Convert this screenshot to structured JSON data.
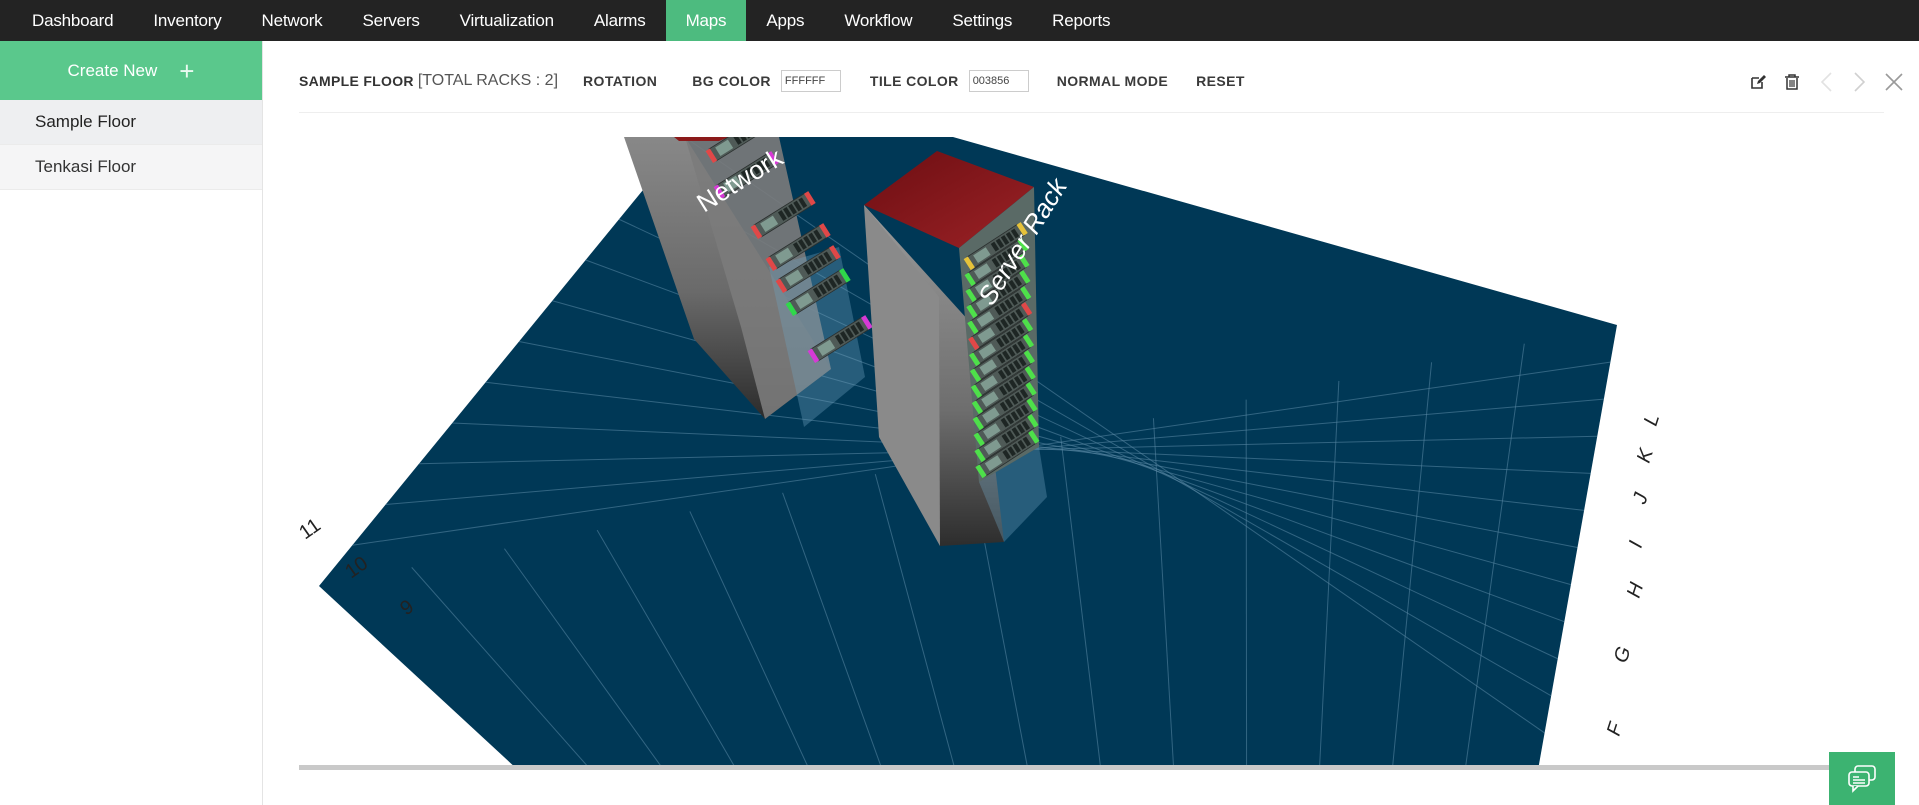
{
  "nav": {
    "items": [
      {
        "label": "Dashboard",
        "active": false
      },
      {
        "label": "Inventory",
        "active": false
      },
      {
        "label": "Network",
        "active": false
      },
      {
        "label": "Servers",
        "active": false
      },
      {
        "label": "Virtualization",
        "active": false
      },
      {
        "label": "Alarms",
        "active": false
      },
      {
        "label": "Maps",
        "active": true
      },
      {
        "label": "Apps",
        "active": false
      },
      {
        "label": "Workflow",
        "active": false
      },
      {
        "label": "Settings",
        "active": false
      },
      {
        "label": "Reports",
        "active": false
      }
    ],
    "active_color": "#4dbb7f"
  },
  "sidebar": {
    "create_new_label": "Create New",
    "create_new_icon": "plus-icon",
    "floors": [
      {
        "label": "Sample Floor",
        "active": true
      },
      {
        "label": "Tenkasi Floor",
        "active": false
      }
    ]
  },
  "toolbar": {
    "floor_title": "SAMPLE FLOOR",
    "total_racks": "[TOTAL RACKS : 2]",
    "rotation_label": "ROTATION",
    "bg_color_label": "BG COLOR",
    "bg_color_value": "FFFFFF",
    "tile_color_label": "TILE COLOR",
    "tile_color_value": "003856",
    "normal_mode_label": "NORMAL MODE",
    "reset_label": "RESET",
    "icons": [
      "edit-icon",
      "trash-icon",
      "chevron-left-icon",
      "chevron-right-icon",
      "close-icon"
    ]
  },
  "floor_map": {
    "tile_color": "#003856",
    "bg_color": "#FFFFFF",
    "row_labels": [
      "F",
      "G",
      "H",
      "I",
      "J",
      "K",
      "L"
    ],
    "column_labels": [
      "11",
      "10",
      "9"
    ],
    "racks": [
      {
        "name": "Network",
        "top_color": "#8b1a1a"
      },
      {
        "name": "Server Rack",
        "top_color": "#8b1a1a"
      }
    ]
  },
  "chat": {
    "icon": "chat-icon"
  }
}
